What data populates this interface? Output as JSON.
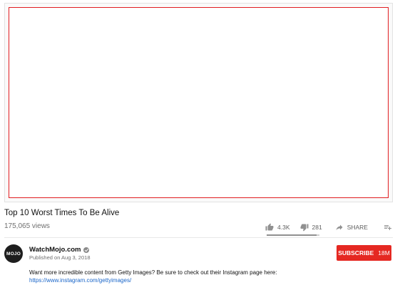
{
  "video": {
    "title": "Top 10 Worst Times To Be Alive",
    "views": "175,065 views",
    "likes": "4.3K",
    "dislikes": "281",
    "like_ratio": 0.94
  },
  "actions": {
    "share_label": "SHARE",
    "like_icon": "thumbs-up-icon",
    "dislike_icon": "thumbs-down-icon",
    "share_icon": "share-arrow-icon",
    "add_icon": "playlist-add-icon",
    "more_icon": "more-horizontal-icon"
  },
  "channel": {
    "avatar_text": "MOJO",
    "name": "WatchMojo.com",
    "published": "Published on Aug 3, 2018",
    "subscribe_label": "SUBSCRIBE",
    "subscriber_count": "18M"
  },
  "description": {
    "text": "Want more incredible content from Getty Images? Be sure to check out their Instagram page here:",
    "link": "https://www.instagram.com/gettyimages/"
  },
  "colors": {
    "subscribe_bg": "#e52822",
    "player_border": "#e11d21",
    "link": "#1a66c9"
  }
}
